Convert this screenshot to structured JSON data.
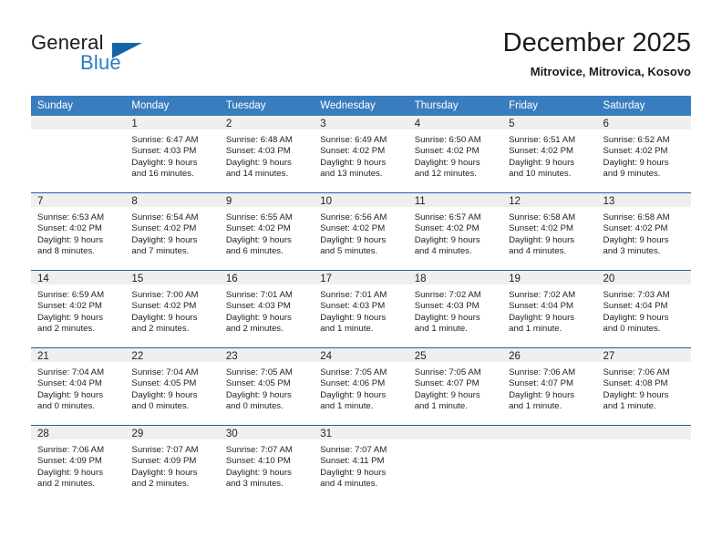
{
  "logo": {
    "primary_text": "General",
    "secondary_text": "Blue",
    "triangle_color": "#1565a8",
    "secondary_color": "#2b7cc4"
  },
  "header": {
    "title": "December 2025",
    "subtitle": "Mitrovice, Mitrovica, Kosovo"
  },
  "colors": {
    "header_row": "#3a7dbf",
    "week_divider": "#1565a8",
    "daynum_band": "#efefef",
    "text": "#222222"
  },
  "weekdays": [
    "Sunday",
    "Monday",
    "Tuesday",
    "Wednesday",
    "Thursday",
    "Friday",
    "Saturday"
  ],
  "weeks": [
    [
      {
        "day": "",
        "blank": true,
        "sunrise": "",
        "sunset": "",
        "daylight_line1": "",
        "daylight_line2": ""
      },
      {
        "day": "1",
        "blank": false,
        "sunrise": "Sunrise: 6:47 AM",
        "sunset": "Sunset: 4:03 PM",
        "daylight_line1": "Daylight: 9 hours",
        "daylight_line2": "and 16 minutes."
      },
      {
        "day": "2",
        "blank": false,
        "sunrise": "Sunrise: 6:48 AM",
        "sunset": "Sunset: 4:03 PM",
        "daylight_line1": "Daylight: 9 hours",
        "daylight_line2": "and 14 minutes."
      },
      {
        "day": "3",
        "blank": false,
        "sunrise": "Sunrise: 6:49 AM",
        "sunset": "Sunset: 4:02 PM",
        "daylight_line1": "Daylight: 9 hours",
        "daylight_line2": "and 13 minutes."
      },
      {
        "day": "4",
        "blank": false,
        "sunrise": "Sunrise: 6:50 AM",
        "sunset": "Sunset: 4:02 PM",
        "daylight_line1": "Daylight: 9 hours",
        "daylight_line2": "and 12 minutes."
      },
      {
        "day": "5",
        "blank": false,
        "sunrise": "Sunrise: 6:51 AM",
        "sunset": "Sunset: 4:02 PM",
        "daylight_line1": "Daylight: 9 hours",
        "daylight_line2": "and 10 minutes."
      },
      {
        "day": "6",
        "blank": false,
        "sunrise": "Sunrise: 6:52 AM",
        "sunset": "Sunset: 4:02 PM",
        "daylight_line1": "Daylight: 9 hours",
        "daylight_line2": "and 9 minutes."
      }
    ],
    [
      {
        "day": "7",
        "blank": false,
        "sunrise": "Sunrise: 6:53 AM",
        "sunset": "Sunset: 4:02 PM",
        "daylight_line1": "Daylight: 9 hours",
        "daylight_line2": "and 8 minutes."
      },
      {
        "day": "8",
        "blank": false,
        "sunrise": "Sunrise: 6:54 AM",
        "sunset": "Sunset: 4:02 PM",
        "daylight_line1": "Daylight: 9 hours",
        "daylight_line2": "and 7 minutes."
      },
      {
        "day": "9",
        "blank": false,
        "sunrise": "Sunrise: 6:55 AM",
        "sunset": "Sunset: 4:02 PM",
        "daylight_line1": "Daylight: 9 hours",
        "daylight_line2": "and 6 minutes."
      },
      {
        "day": "10",
        "blank": false,
        "sunrise": "Sunrise: 6:56 AM",
        "sunset": "Sunset: 4:02 PM",
        "daylight_line1": "Daylight: 9 hours",
        "daylight_line2": "and 5 minutes."
      },
      {
        "day": "11",
        "blank": false,
        "sunrise": "Sunrise: 6:57 AM",
        "sunset": "Sunset: 4:02 PM",
        "daylight_line1": "Daylight: 9 hours",
        "daylight_line2": "and 4 minutes."
      },
      {
        "day": "12",
        "blank": false,
        "sunrise": "Sunrise: 6:58 AM",
        "sunset": "Sunset: 4:02 PM",
        "daylight_line1": "Daylight: 9 hours",
        "daylight_line2": "and 4 minutes."
      },
      {
        "day": "13",
        "blank": false,
        "sunrise": "Sunrise: 6:58 AM",
        "sunset": "Sunset: 4:02 PM",
        "daylight_line1": "Daylight: 9 hours",
        "daylight_line2": "and 3 minutes."
      }
    ],
    [
      {
        "day": "14",
        "blank": false,
        "sunrise": "Sunrise: 6:59 AM",
        "sunset": "Sunset: 4:02 PM",
        "daylight_line1": "Daylight: 9 hours",
        "daylight_line2": "and 2 minutes."
      },
      {
        "day": "15",
        "blank": false,
        "sunrise": "Sunrise: 7:00 AM",
        "sunset": "Sunset: 4:02 PM",
        "daylight_line1": "Daylight: 9 hours",
        "daylight_line2": "and 2 minutes."
      },
      {
        "day": "16",
        "blank": false,
        "sunrise": "Sunrise: 7:01 AM",
        "sunset": "Sunset: 4:03 PM",
        "daylight_line1": "Daylight: 9 hours",
        "daylight_line2": "and 2 minutes."
      },
      {
        "day": "17",
        "blank": false,
        "sunrise": "Sunrise: 7:01 AM",
        "sunset": "Sunset: 4:03 PM",
        "daylight_line1": "Daylight: 9 hours",
        "daylight_line2": "and 1 minute."
      },
      {
        "day": "18",
        "blank": false,
        "sunrise": "Sunrise: 7:02 AM",
        "sunset": "Sunset: 4:03 PM",
        "daylight_line1": "Daylight: 9 hours",
        "daylight_line2": "and 1 minute."
      },
      {
        "day": "19",
        "blank": false,
        "sunrise": "Sunrise: 7:02 AM",
        "sunset": "Sunset: 4:04 PM",
        "daylight_line1": "Daylight: 9 hours",
        "daylight_line2": "and 1 minute."
      },
      {
        "day": "20",
        "blank": false,
        "sunrise": "Sunrise: 7:03 AM",
        "sunset": "Sunset: 4:04 PM",
        "daylight_line1": "Daylight: 9 hours",
        "daylight_line2": "and 0 minutes."
      }
    ],
    [
      {
        "day": "21",
        "blank": false,
        "sunrise": "Sunrise: 7:04 AM",
        "sunset": "Sunset: 4:04 PM",
        "daylight_line1": "Daylight: 9 hours",
        "daylight_line2": "and 0 minutes."
      },
      {
        "day": "22",
        "blank": false,
        "sunrise": "Sunrise: 7:04 AM",
        "sunset": "Sunset: 4:05 PM",
        "daylight_line1": "Daylight: 9 hours",
        "daylight_line2": "and 0 minutes."
      },
      {
        "day": "23",
        "blank": false,
        "sunrise": "Sunrise: 7:05 AM",
        "sunset": "Sunset: 4:05 PM",
        "daylight_line1": "Daylight: 9 hours",
        "daylight_line2": "and 0 minutes."
      },
      {
        "day": "24",
        "blank": false,
        "sunrise": "Sunrise: 7:05 AM",
        "sunset": "Sunset: 4:06 PM",
        "daylight_line1": "Daylight: 9 hours",
        "daylight_line2": "and 1 minute."
      },
      {
        "day": "25",
        "blank": false,
        "sunrise": "Sunrise: 7:05 AM",
        "sunset": "Sunset: 4:07 PM",
        "daylight_line1": "Daylight: 9 hours",
        "daylight_line2": "and 1 minute."
      },
      {
        "day": "26",
        "blank": false,
        "sunrise": "Sunrise: 7:06 AM",
        "sunset": "Sunset: 4:07 PM",
        "daylight_line1": "Daylight: 9 hours",
        "daylight_line2": "and 1 minute."
      },
      {
        "day": "27",
        "blank": false,
        "sunrise": "Sunrise: 7:06 AM",
        "sunset": "Sunset: 4:08 PM",
        "daylight_line1": "Daylight: 9 hours",
        "daylight_line2": "and 1 minute."
      }
    ],
    [
      {
        "day": "28",
        "blank": false,
        "sunrise": "Sunrise: 7:06 AM",
        "sunset": "Sunset: 4:09 PM",
        "daylight_line1": "Daylight: 9 hours",
        "daylight_line2": "and 2 minutes."
      },
      {
        "day": "29",
        "blank": false,
        "sunrise": "Sunrise: 7:07 AM",
        "sunset": "Sunset: 4:09 PM",
        "daylight_line1": "Daylight: 9 hours",
        "daylight_line2": "and 2 minutes."
      },
      {
        "day": "30",
        "blank": false,
        "sunrise": "Sunrise: 7:07 AM",
        "sunset": "Sunset: 4:10 PM",
        "daylight_line1": "Daylight: 9 hours",
        "daylight_line2": "and 3 minutes."
      },
      {
        "day": "31",
        "blank": false,
        "sunrise": "Sunrise: 7:07 AM",
        "sunset": "Sunset: 4:11 PM",
        "daylight_line1": "Daylight: 9 hours",
        "daylight_line2": "and 4 minutes."
      },
      {
        "day": "",
        "blank": true,
        "sunrise": "",
        "sunset": "",
        "daylight_line1": "",
        "daylight_line2": ""
      },
      {
        "day": "",
        "blank": true,
        "sunrise": "",
        "sunset": "",
        "daylight_line1": "",
        "daylight_line2": ""
      },
      {
        "day": "",
        "blank": true,
        "sunrise": "",
        "sunset": "",
        "daylight_line1": "",
        "daylight_line2": ""
      }
    ]
  ]
}
